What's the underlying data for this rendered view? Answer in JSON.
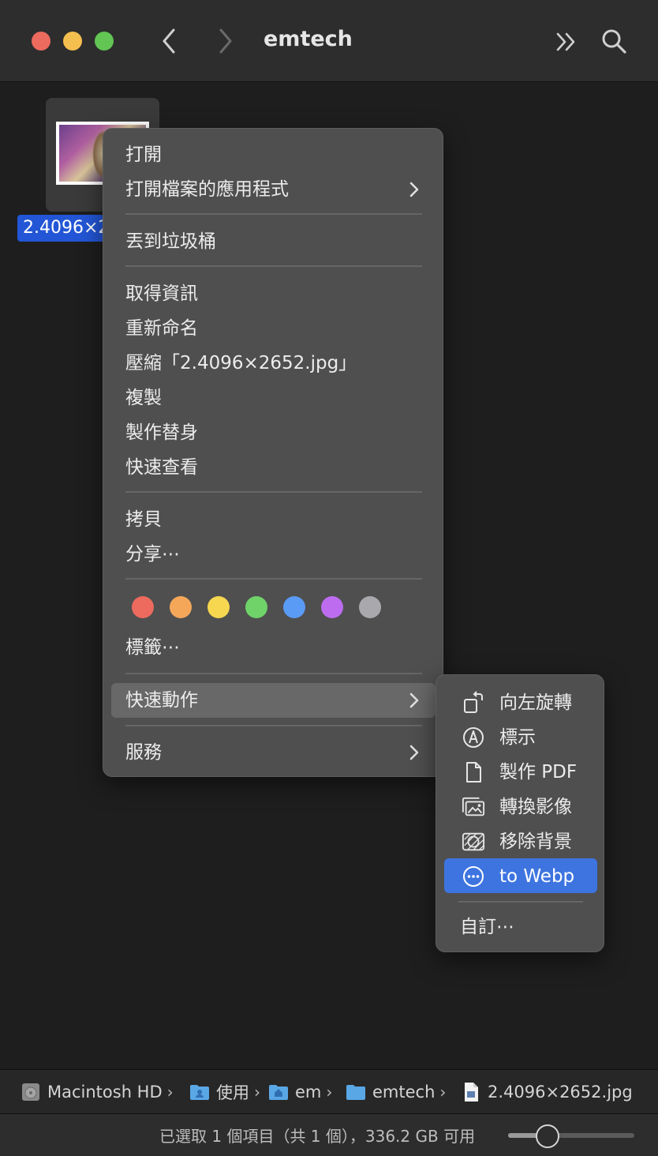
{
  "window": {
    "title": "emtech"
  },
  "file": {
    "label": "2.4096×2652.jpg"
  },
  "context_menu": {
    "items": [
      {
        "label": "打開",
        "submenu": false
      },
      {
        "label": "打開檔案的應用程式",
        "submenu": true
      },
      {
        "label": "丟到垃圾桶",
        "submenu": false
      },
      {
        "label": "取得資訊",
        "submenu": false
      },
      {
        "label": "重新命名",
        "submenu": false
      },
      {
        "label": "壓縮「2.4096×2652.jpg」",
        "submenu": false
      },
      {
        "label": "複製",
        "submenu": false
      },
      {
        "label": "製作替身",
        "submenu": false
      },
      {
        "label": "快速查看",
        "submenu": false
      },
      {
        "label": "拷貝",
        "submenu": false
      },
      {
        "label": "分享⋯",
        "submenu": false
      },
      {
        "label": "標籤⋯",
        "submenu": false
      },
      {
        "label": "快速動作",
        "submenu": true
      },
      {
        "label": "服務",
        "submenu": true
      }
    ],
    "tag_colors": [
      "#ec6a5e",
      "#f4a759",
      "#f7d74f",
      "#6fd36a",
      "#5a9bf5",
      "#bd6cf0",
      "#a9a9ad"
    ]
  },
  "quick_actions": {
    "items": [
      {
        "label": "向左旋轉",
        "icon": "rotate-left-icon"
      },
      {
        "label": "標示",
        "icon": "markup-icon"
      },
      {
        "label": "製作 PDF",
        "icon": "document-icon"
      },
      {
        "label": "轉換影像",
        "icon": "convert-image-icon"
      },
      {
        "label": "移除背景",
        "icon": "remove-background-icon"
      },
      {
        "label": "to Webp",
        "icon": "more-circle-icon"
      }
    ],
    "customize_label": "自訂⋯",
    "highlight_color": "#3d74e0"
  },
  "path_bar": {
    "items": [
      {
        "label": "Macintosh HD",
        "icon": "hard-drive-icon"
      },
      {
        "label": "使用",
        "icon": "users-folder-icon"
      },
      {
        "label": "em",
        "icon": "home-folder-icon"
      },
      {
        "label": "emtech",
        "icon": "folder-icon"
      },
      {
        "label": "2.4096×2652.jpg",
        "icon": "jpeg-file-icon"
      }
    ]
  },
  "status_bar": {
    "text": "已選取 1 個項目（共 1 個），336.2 GB 可用",
    "zoom_fraction": 0.27
  },
  "colors": {
    "accent": "#2356d6",
    "menu_bg": "#4f4f4f"
  }
}
